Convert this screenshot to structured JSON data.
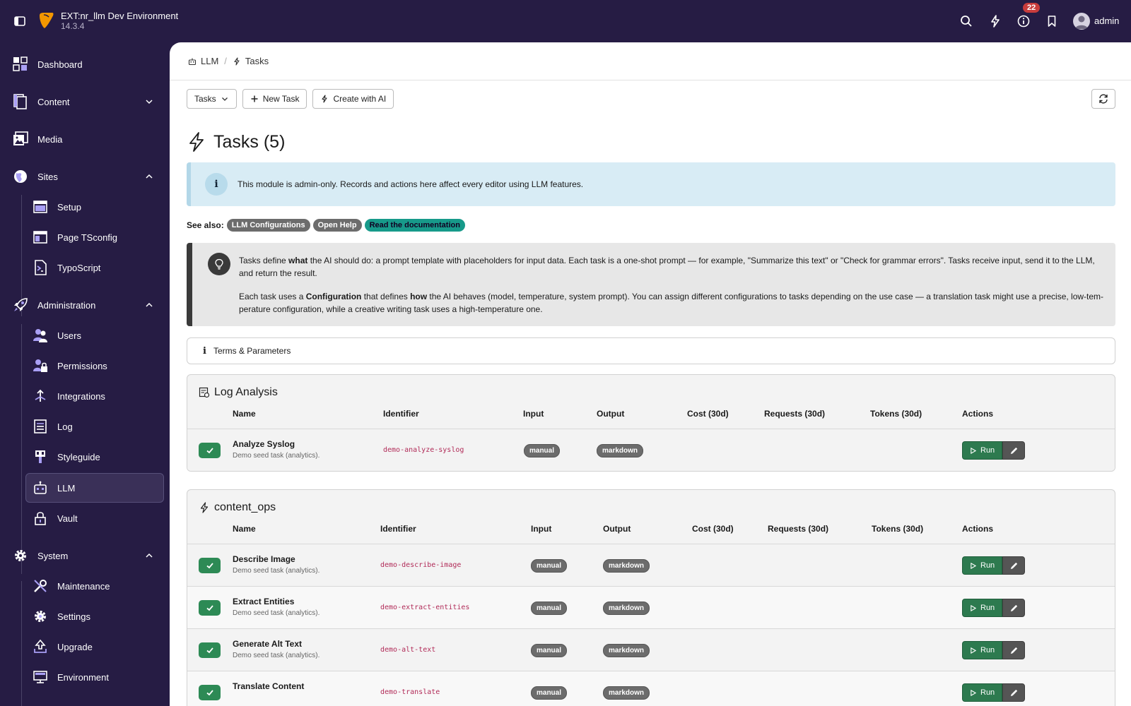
{
  "topbar": {
    "title": "EXT:nr_llm Dev Environment",
    "version": "14.3.4",
    "notification_count": "22",
    "username": "admin"
  },
  "sidebar": {
    "items": [
      {
        "label": "Dashboard",
        "icon": "dashboard-icon"
      },
      {
        "label": "Content",
        "icon": "content-icon"
      },
      {
        "label": "Media",
        "icon": "media-icon"
      },
      {
        "label": "Sites",
        "icon": "sites-icon"
      },
      {
        "label": "Setup",
        "icon": "setup-icon"
      },
      {
        "label": "Page TSconfig",
        "icon": "page-tsconfig-icon"
      },
      {
        "label": "TypoScript",
        "icon": "typoscript-icon"
      },
      {
        "label": "Administration",
        "icon": "administration-icon"
      },
      {
        "label": "Users",
        "icon": "users-icon"
      },
      {
        "label": "Permissions",
        "icon": "permissions-icon"
      },
      {
        "label": "Integrations",
        "icon": "integrations-icon"
      },
      {
        "label": "Log",
        "icon": "log-icon"
      },
      {
        "label": "Styleguide",
        "icon": "styleguide-icon"
      },
      {
        "label": "LLM",
        "icon": "llm-icon"
      },
      {
        "label": "Vault",
        "icon": "vault-icon"
      },
      {
        "label": "System",
        "icon": "system-icon"
      },
      {
        "label": "Maintenance",
        "icon": "maintenance-icon"
      },
      {
        "label": "Settings",
        "icon": "settings-icon"
      },
      {
        "label": "Upgrade",
        "icon": "upgrade-icon"
      },
      {
        "label": "Environment",
        "icon": "environment-icon"
      }
    ]
  },
  "breadcrumb": {
    "parent": "LLM",
    "current": "Tasks"
  },
  "toolbar": {
    "dropdown_label": "Tasks",
    "new_task_label": "New Task",
    "create_ai_label": "Create with AI"
  },
  "page": {
    "title": "Tasks (5)"
  },
  "info_callout": {
    "text": "This module is admin-only. Records and actions here affect every editor using LLM features."
  },
  "see_also": {
    "label": "See also:",
    "links": [
      "LLM Configurations",
      "Open Help",
      "Read the documentation"
    ]
  },
  "note": {
    "p1_a": "Tasks define ",
    "p1_b": "what",
    "p1_c": " the AI should do: a prompt template with placeholders for input data. Each task is a one-shot prompt — for example, \"Summarize this text\" or \"Check for grammar errors\". Tasks receive input, send it to the LLM, and return the result.",
    "p2_a": "Each task uses a ",
    "p2_b": "Configuration",
    "p2_c": " that defines ",
    "p2_d": "how",
    "p2_e": " the AI behaves (model, temperature, system prompt). You can assign different configurations to tasks depending on the use case — a translation task might use a precise, low-tem-perature configuration, while a creative writing task uses a high-temperature one."
  },
  "terms": {
    "label": "Terms & Parameters"
  },
  "table_headers": {
    "name": "Name",
    "identifier": "Identifier",
    "input": "Input",
    "output": "Output",
    "cost": "Cost (30d)",
    "requests": "Requests (30d)",
    "tokens": "Tokens (30d)",
    "actions": "Actions"
  },
  "groups": [
    {
      "title": "Log Analysis",
      "rows": [
        {
          "name": "Analyze Syslog",
          "desc": "Demo seed task (analytics).",
          "identifier": "demo-analyze-syslog",
          "input": "manual",
          "output": "markdown"
        }
      ]
    },
    {
      "title": "content_ops",
      "rows": [
        {
          "name": "Describe Image",
          "desc": "Demo seed task (analytics).",
          "identifier": "demo-describe-image",
          "input": "manual",
          "output": "markdown"
        },
        {
          "name": "Extract Entities",
          "desc": "Demo seed task (analytics).",
          "identifier": "demo-extract-entities",
          "input": "manual",
          "output": "markdown"
        },
        {
          "name": "Generate Alt Text",
          "desc": "Demo seed task (analytics).",
          "identifier": "demo-alt-text",
          "input": "manual",
          "output": "markdown"
        },
        {
          "name": "Translate Content",
          "desc": "",
          "identifier": "demo-translate",
          "input": "manual",
          "output": "markdown"
        }
      ]
    }
  ],
  "run_label": "Run",
  "colors": {
    "sidebar_bg": "#261c44",
    "success": "#2d7a4f",
    "info_bg": "#d8ecf5",
    "teal_tag": "#179a8a",
    "identifier": "#b12b58"
  }
}
